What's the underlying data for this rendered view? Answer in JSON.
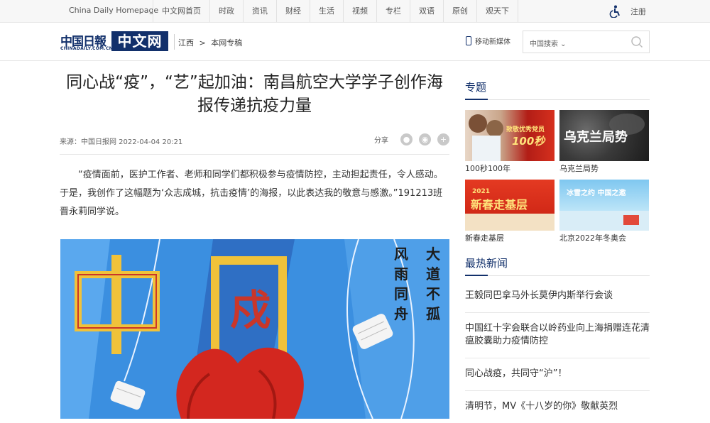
{
  "topbar": {
    "home": "China Daily Homepage",
    "nav": [
      "中文网首页",
      "时政",
      "资讯",
      "财经",
      "生活",
      "视频",
      "专栏",
      "双语",
      "原创",
      "观天下"
    ],
    "login": "注册"
  },
  "header": {
    "logo_cd": "中国日報",
    "logo_sub": "CHINADAILY.COM.CN",
    "logo_zw": "中文网",
    "breadcrumb": [
      "江西",
      ">",
      "本网专稿"
    ],
    "mobile": "移动新媒体",
    "search_select": "中国搜索"
  },
  "article": {
    "title": "同心战“疫”，“艺”起加油：南昌航空大学学子创作海报传递抗疫力量",
    "source": "来源：中国日报网 2022-04-04 20:21",
    "share_label": "分享",
    "paragraph": "“疫情面前，医护工作者、老师和同学们都积极参与疫情防控，主动担起责任，令人感动。于是，我创作了这幅题为‘众志成城，抗击疫情’的海报，以此表达我的敬意与感激。”191213班晋永莉同学说。",
    "poster": {
      "big_chars": [
        "中",
        "国"
      ],
      "inner_char": "戍",
      "col1": [
        "风",
        "雨",
        "同",
        "舟"
      ],
      "col2": [
        "大",
        "道",
        "不",
        "孤"
      ]
    }
  },
  "sidebar": {
    "topics_title": "专题",
    "topics": [
      {
        "caption": "100秒100年",
        "overlay": "致敬优秀党员",
        "overlay2": "100秒"
      },
      {
        "caption": "乌克兰局势",
        "overlay": "乌克兰局势",
        "overlay2": ""
      },
      {
        "caption": "新春走基层",
        "overlay": "2021",
        "overlay2": "新春走基层"
      },
      {
        "caption": "北京2022年冬奥会",
        "overlay": "冰雪之约 中国之邀",
        "overlay2": ""
      }
    ],
    "hot_title": "最热新闻",
    "hot": [
      "王毅同巴拿马外长莫伊内斯举行会谈",
      "中国红十字会联合以岭药业向上海捐赠连花清瘟胶囊助力疫情防控",
      "同心战疫，共同守“沪”！",
      "清明节，MV《十八岁的你》敬献英烈"
    ]
  }
}
